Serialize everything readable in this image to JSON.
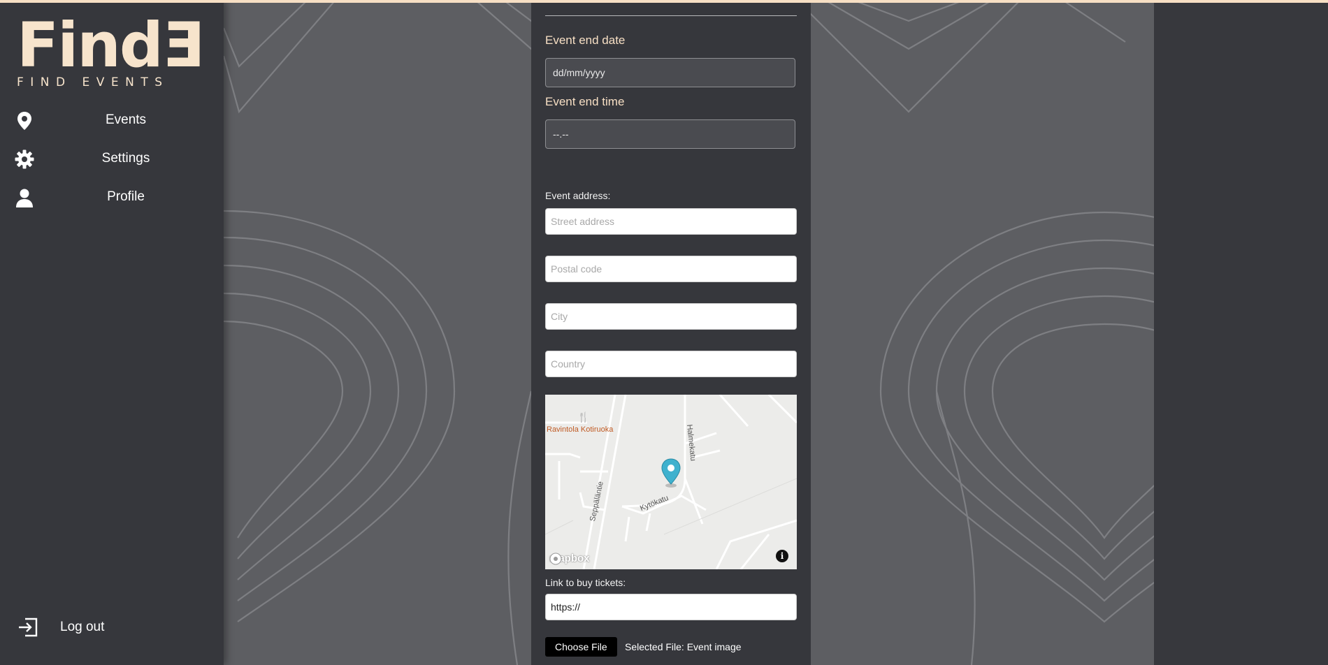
{
  "brand": {
    "logo_main": "FindƎ",
    "logo_sub": "FIND EVENTS"
  },
  "sidebar": {
    "items": [
      {
        "label": "Events",
        "icon": "map-pin-icon"
      },
      {
        "label": "Settings",
        "icon": "gear-icon"
      },
      {
        "label": "Profile",
        "icon": "user-icon"
      }
    ],
    "logout_label": "Log out"
  },
  "form": {
    "end_date_label": "Event end date",
    "end_date_value": "dd/mm/yyyy",
    "end_time_label": "Event end time",
    "end_time_value": "--.--",
    "address_label": "Event address:",
    "street_placeholder": "Street address",
    "postal_placeholder": "Postal code",
    "city_placeholder": "City",
    "country_placeholder": "Country",
    "tickets_label": "Link to buy tickets:",
    "tickets_value": "https://",
    "choose_file_label": "Choose File",
    "selected_file_text": "Selected File: Event image"
  },
  "map": {
    "poi": "Ravintola Kotiruoka",
    "streets": [
      "Seppäläntie",
      "Kytökatu",
      "Halmekatu"
    ],
    "attribution": "mapbox",
    "marker_color": "#3fb1ce"
  },
  "colors": {
    "accent": "#f7dfc4",
    "sidebar_bg": "#36373c",
    "page_bg": "#5d5e62"
  }
}
